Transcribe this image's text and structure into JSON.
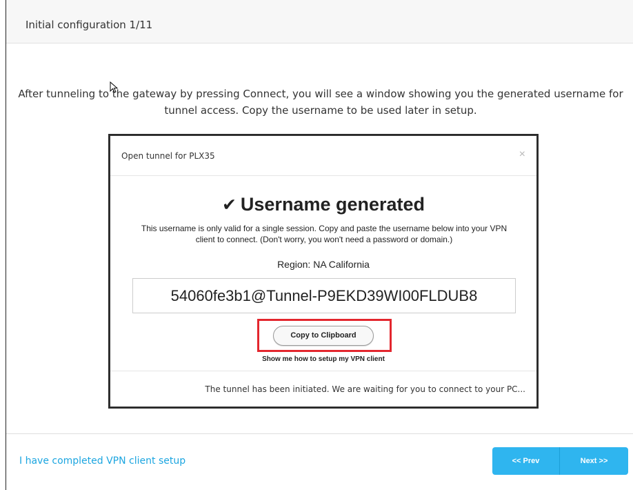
{
  "header": {
    "title": "Initial configuration 1/11"
  },
  "instructions": "After tunneling to the gateway by pressing Connect, you will see a window showing you the generated username for tunnel access. Copy the username to be used later in setup.",
  "modal": {
    "title": "Open tunnel for PLX35",
    "close_glyph": "×",
    "heading": "Username generated",
    "check_glyph": "✔",
    "explanation": "This username is only valid for a single session. Copy and paste the username below into your VPN client to connect. (Don't worry, you won't need a password or domain.)",
    "region": "Region: NA California",
    "username": "54060fe3b1@Tunnel-P9EKD39WI00FLDUB8",
    "copy_button": "Copy to Clipboard",
    "vpn_help_link": "Show me how to setup my VPN client",
    "status": "The tunnel has been initiated. We are waiting for you to connect to your PC..."
  },
  "footer": {
    "vpn_complete_link": "I have completed VPN client setup",
    "prev_label": "<< Prev",
    "next_label": "Next >>"
  },
  "colors": {
    "accent_blue": "#2fb5ef",
    "link_blue": "#1ba5e0",
    "highlight_red": "#e3262e"
  }
}
